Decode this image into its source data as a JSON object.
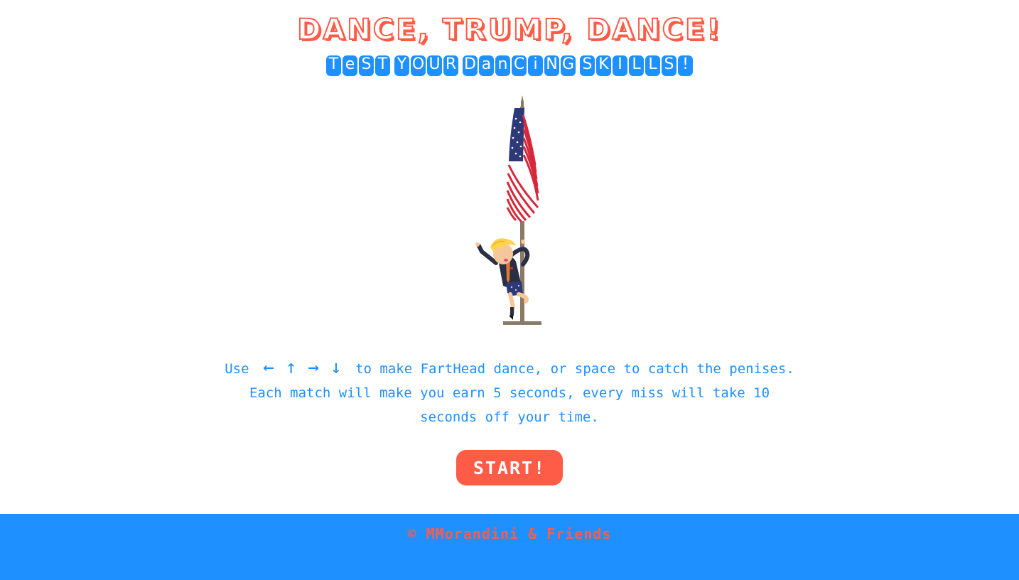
{
  "title": "DANCE, TRUMP, DANCE!",
  "subtitle": {
    "text": "TEST YOUR DANCING SKILLS!",
    "words": [
      [
        "T",
        "e",
        "S",
        "T"
      ],
      [
        "Y",
        "O",
        "U",
        "R"
      ],
      [
        "D",
        "a",
        "n",
        "C",
        "i",
        "N",
        "G"
      ],
      [
        "S",
        "K",
        "I",
        "L",
        "L",
        "S",
        "!"
      ]
    ]
  },
  "instructions": {
    "use": "Use",
    "arrows": [
      "←",
      "↑",
      "→",
      "↓"
    ],
    "line1_rest": "to make FartHead dance, or space to catch the penises.",
    "line2": "Each match will make you earn 5 seconds, every miss will take 10",
    "line3": "seconds off your time."
  },
  "start_button": "START!",
  "footer": "© MMorandini & Friends",
  "colors": {
    "accent_red": "#ff5c47",
    "accent_blue": "#1e90ff",
    "background": "#ffffff"
  },
  "scene": {
    "character": "dancing-character",
    "prop": "flag-pole-with-us-flag"
  }
}
